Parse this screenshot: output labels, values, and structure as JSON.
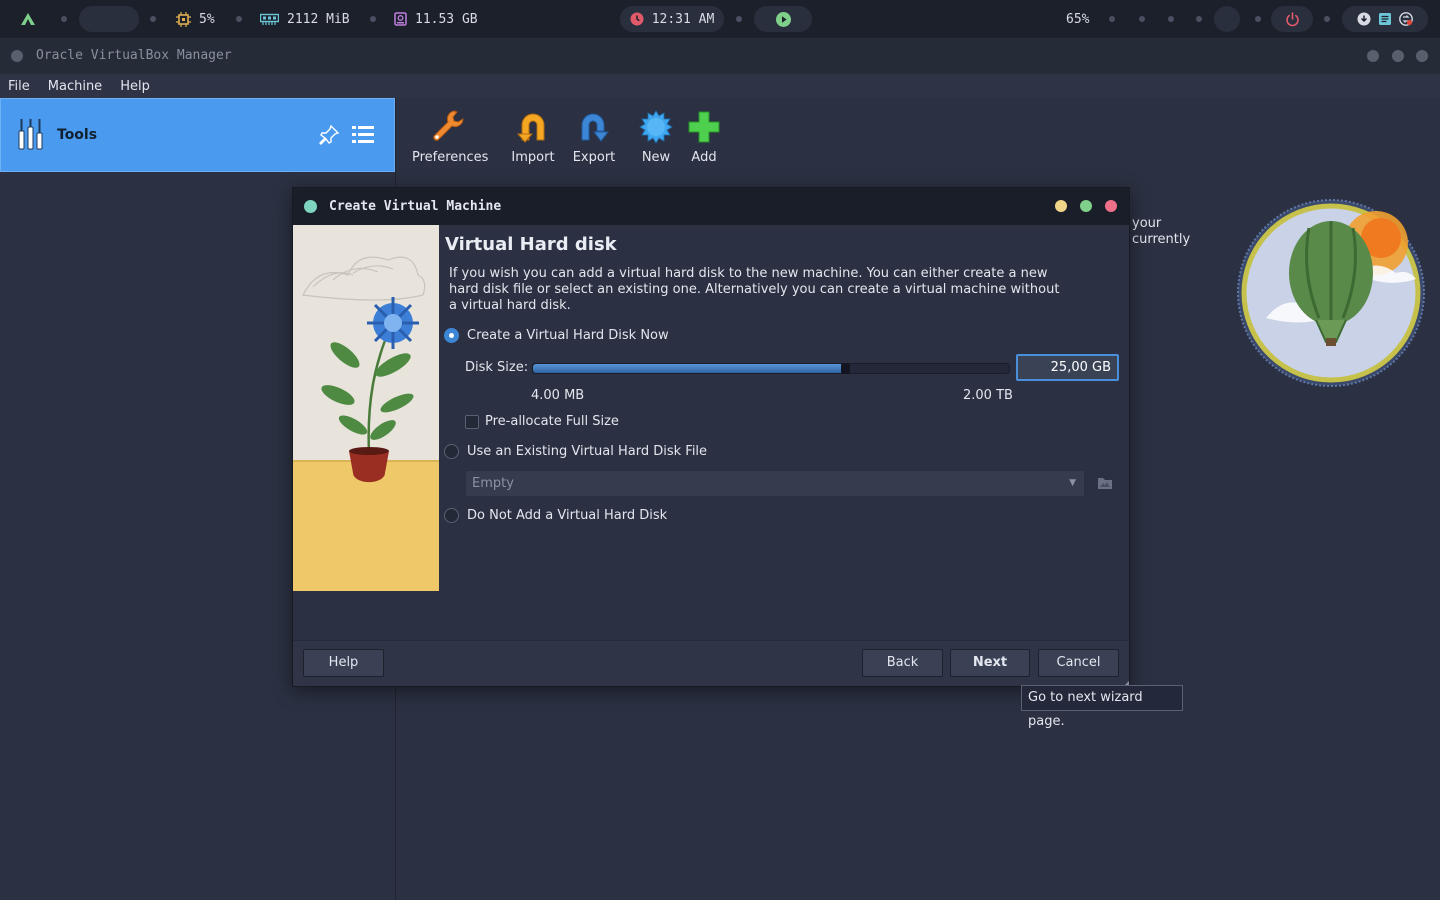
{
  "topbar": {
    "cpu": "5%",
    "memory": "2112 MiB",
    "disk": "11.53 GB",
    "clock": "12:31 AM",
    "volume": "65%"
  },
  "window": {
    "title": "Oracle VirtualBox Manager"
  },
  "menu": {
    "file": "File",
    "machine": "Machine",
    "help": "Help"
  },
  "sidebar": {
    "tools_label": "Tools"
  },
  "toolbar": {
    "preferences": "Preferences",
    "import": "Import",
    "export": "Export",
    "new": "New",
    "add": "Add"
  },
  "background_text": {
    "line1": "your",
    "line2": "currently"
  },
  "dialog": {
    "title": "Create Virtual Machine",
    "heading": "Virtual Hard disk",
    "description": "If you wish you can add a virtual hard disk to the new machine. You can either create a new hard disk file or select an existing one. Alternatively you can create a virtual machine without a virtual hard disk.",
    "option_create": "Create a Virtual Hard Disk Now",
    "disk_size_label": "Disk Size:",
    "disk_size_value": "25,00 GB",
    "disk_size_fraction": 0.655,
    "min_size": "4.00 MB",
    "max_size": "2.00 TB",
    "preallocate_label": "Pre-allocate Full Size",
    "option_existing": "Use an Existing Virtual Hard Disk File",
    "existing_file_value": "Empty",
    "option_none": "Do Not Add a Virtual Hard Disk",
    "selected_option": "create",
    "buttons": {
      "help": "Help",
      "back": "Back",
      "next": "Next",
      "cancel": "Cancel"
    },
    "tooltip": "Go to next wizard page."
  },
  "colors": {
    "accent": "#4a9bf0",
    "traffic_yellow": "#f0d488",
    "traffic_green": "#7fd08a",
    "traffic_red": "#f0708a",
    "dialog_dot": "#7fd4c0"
  }
}
